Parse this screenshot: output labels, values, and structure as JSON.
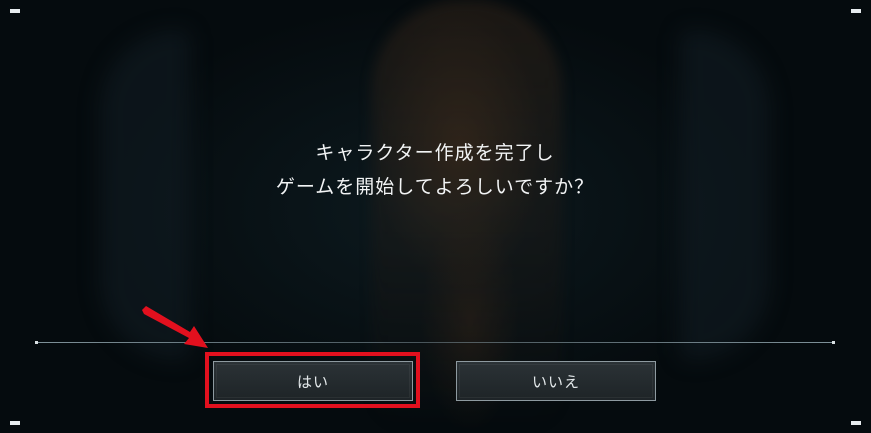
{
  "dialog": {
    "message_line1": "キャラクター作成を完了し",
    "message_line2": "ゲームを開始してよろしいですか？",
    "yes_label": "はい",
    "no_label": "いいえ"
  },
  "annotation": {
    "highlight_color": "#e2101e",
    "target": "yes-button"
  },
  "colors": {
    "background": "#04090b",
    "button_fill": "#24292c",
    "button_border": "#8e9aa0",
    "text": "#f2f4f5"
  }
}
